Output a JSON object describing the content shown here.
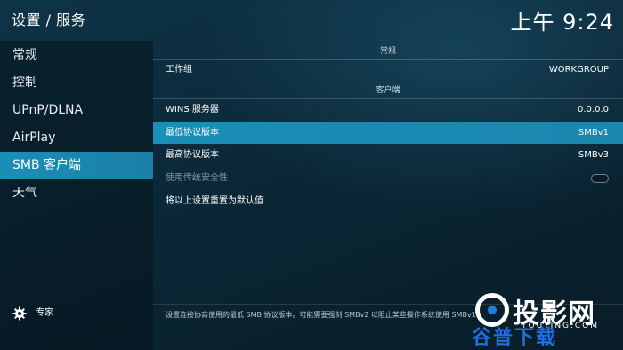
{
  "header": {
    "title": "设置 / 服务",
    "clock": "上午 9:24"
  },
  "sidebar": {
    "items": [
      {
        "label": "常规"
      },
      {
        "label": "控制"
      },
      {
        "label": "UPnP/DLNA"
      },
      {
        "label": "AirPlay"
      },
      {
        "label": "SMB 客户端",
        "selected": true
      },
      {
        "label": "天气"
      }
    ],
    "expert_label": "专家",
    "expert_icon": "gear-icon"
  },
  "content": {
    "section_general": "常规",
    "workgroup_label": "工作组",
    "workgroup_value": "WORKGROUP",
    "section_client": "客户端",
    "wins_label": "WINS 服务器",
    "wins_value": "0.0.0.0",
    "min_protocol_label": "最低协议版本",
    "min_protocol_value": "SMBv1",
    "max_protocol_label": "最高协议版本",
    "max_protocol_value": "SMBv3",
    "legacy_security_label": "使用传统安全性",
    "legacy_security_enabled": false,
    "reset_label": "将以上设置重置为默认值",
    "hint": "设置连接协商使用的最低 SMB 协议版本。可能需要强制 SMBv2 以阻止某些操作系统使用 SMBv1"
  },
  "watermark": {
    "brand": "投影网",
    "domain": "TOUYING.COM",
    "sub": "谷普下载"
  },
  "colors": {
    "accent": "#1a8fb8",
    "background": "#0b2838"
  }
}
